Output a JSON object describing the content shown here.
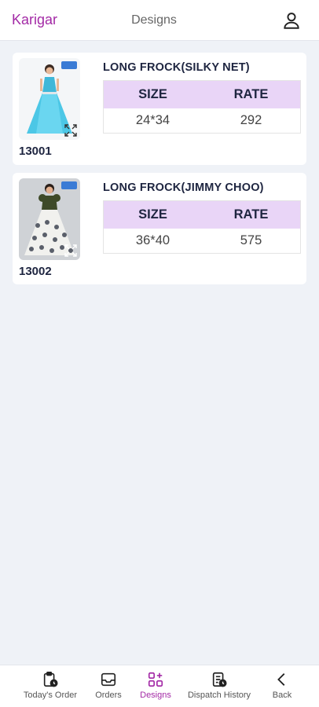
{
  "header": {
    "brand": "Karigar",
    "title": "Designs"
  },
  "products": [
    {
      "name": "LONG FROCK(SILKY NET)",
      "code": "13001",
      "size_header": "SIZE",
      "rate_header": "RATE",
      "size": "24*34",
      "rate": "292"
    },
    {
      "name": "LONG FROCK(JIMMY CHOO)",
      "code": "13002",
      "size_header": "SIZE",
      "rate_header": "RATE",
      "size": "36*40",
      "rate": "575"
    }
  ],
  "nav": [
    {
      "label": "Today's Order",
      "icon": "clipboard-clock-icon"
    },
    {
      "label": "Orders",
      "icon": "inbox-icon"
    },
    {
      "label": "Designs",
      "icon": "grid-plus-icon",
      "active": true
    },
    {
      "label": "Dispatch History",
      "icon": "document-clock-icon"
    },
    {
      "label": "Back",
      "icon": "chevron-left-icon"
    }
  ],
  "colors": {
    "brand": "#a32aa6",
    "table_header": "#e9d5f7",
    "background": "#eff2f7"
  }
}
